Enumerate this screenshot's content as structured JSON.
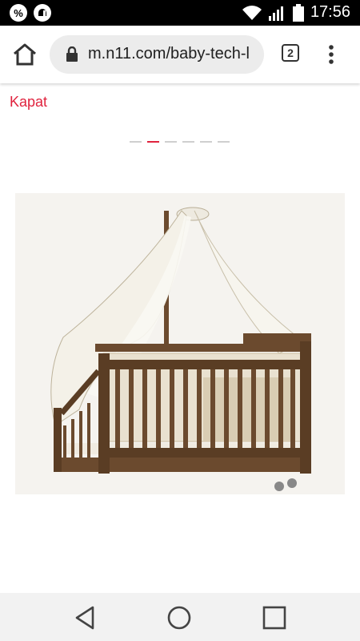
{
  "status_bar": {
    "time": "17:56",
    "icons": [
      "discount-icon",
      "notification-icon",
      "wifi-icon",
      "signal-icon",
      "battery-icon"
    ],
    "discount_glyph": "%"
  },
  "browser": {
    "url": "m.n11.com/baby-tech-l",
    "tab_count": "2"
  },
  "page": {
    "close_label": "Kapat",
    "carousel": {
      "count": 6,
      "active_index": 1
    },
    "image": {
      "subject": "crib-with-canopy"
    }
  },
  "nav_bar": {
    "buttons": [
      "back",
      "home",
      "recents"
    ]
  },
  "colors": {
    "accent": "#e0233e",
    "wood": "#6b4a2e"
  }
}
